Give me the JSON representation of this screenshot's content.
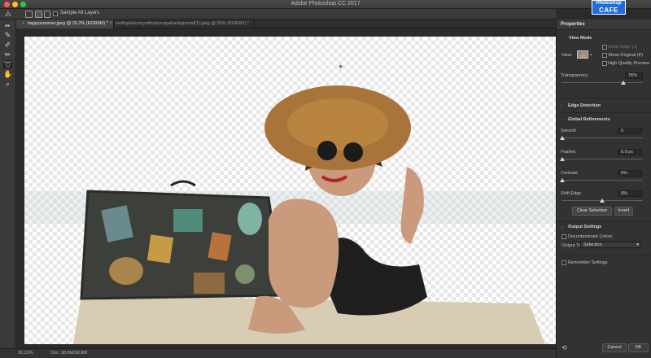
{
  "window": {
    "title": "Adobe Photoshop CC 2017"
  },
  "logo": {
    "line1": "Photoshop",
    "line2": "CAFE"
  },
  "options_bar": {
    "sample_all_layers": "Sample All Layers"
  },
  "tabs": [
    {
      "label": "happysummer.jpeg @ 26.2% (RGB/8#) *",
      "active": true
    },
    {
      "label": "rooftopbalconywithcityscapebackground(1).jpeg @ 25% (RGB/8#) *",
      "active": false
    }
  ],
  "tools": [
    "quick-selection-brush-icon",
    "refine-edge-brush-icon",
    "brush-icon",
    "lasso-icon",
    "hand-icon",
    "zoom-icon"
  ],
  "status": {
    "zoom": "26.22%",
    "doc": "Doc: 38.8M/38.8M"
  },
  "properties": {
    "title": "Properties",
    "view_mode": {
      "heading": "View Mode",
      "view_label": "View:",
      "show_edge": "Show Edge (J)",
      "show_original": "Show Original (P)",
      "high_quality_preview": "High Quality Preview",
      "show_edge_checked": false,
      "show_original_checked": false,
      "high_quality_checked": false
    },
    "transparency": {
      "label": "Transparency",
      "value": "76%",
      "fraction": 0.76
    },
    "edge_detection": {
      "heading": "Edge Detection"
    },
    "global_refinements": {
      "heading": "Global Refinements",
      "smooth": {
        "label": "Smooth",
        "value": "0",
        "fraction": 0.0
      },
      "feather": {
        "label": "Feather",
        "value": "0.0 px",
        "fraction": 0.0
      },
      "contrast": {
        "label": "Contrast",
        "value": "0%",
        "fraction": 0.0
      },
      "shift_edge": {
        "label": "Shift Edge",
        "value": "0%",
        "fraction": 0.5
      }
    },
    "clear_selection": "Clear Selection",
    "invert": "Invert",
    "output_settings": {
      "heading": "Output Settings",
      "decontaminate": "Decontaminate Colors",
      "output_to_label": "Output To:",
      "output_to_value": "Selection"
    },
    "remember_settings": "Remember Settings",
    "cancel": "Cancel",
    "ok": "OK"
  }
}
